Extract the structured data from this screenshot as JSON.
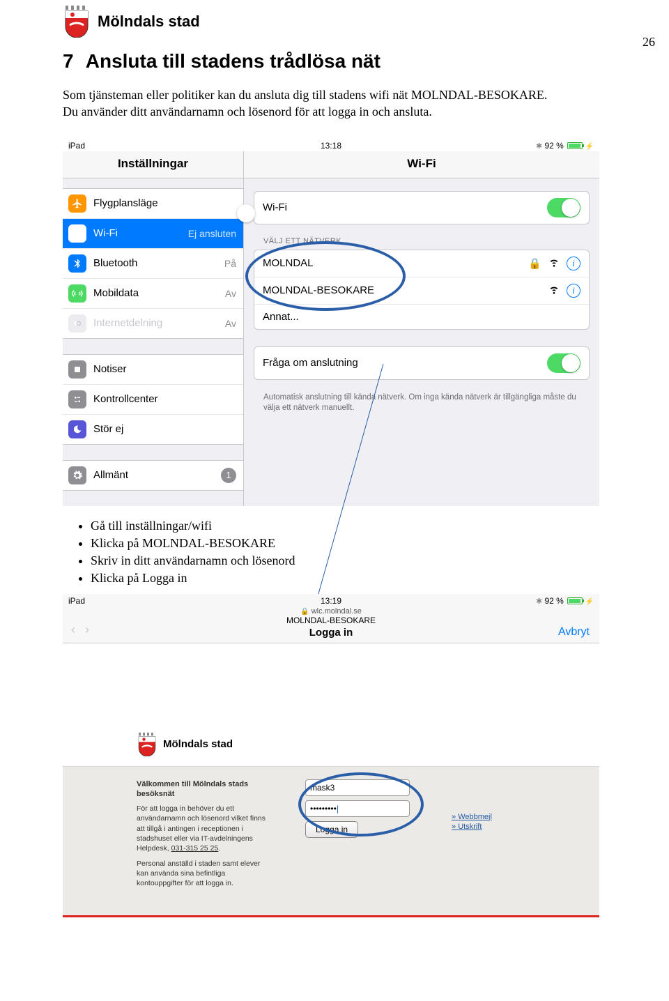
{
  "doc": {
    "brand": "Mölndals stad",
    "page_number": "26",
    "section_number": "7",
    "section_title": "Ansluta till stadens trådlösa nät",
    "para1": "Som tjänsteman eller politiker kan du ansluta dig till stadens wifi nät MOLNDAL-BESOKARE.",
    "para2": "Du använder ditt användarnamn och lösenord för att logga in och ansluta.",
    "bullets": [
      "Gå till inställningar/wifi",
      "Klicka på MOLNDAL-BESOKARE",
      "Skriv in ditt användarnamn och lösenord",
      "Klicka på Logga in"
    ]
  },
  "shot1": {
    "device": "iPad",
    "time": "13:18",
    "battery": "92 %",
    "left_title": "Inställningar",
    "right_title": "Wi-Fi",
    "group1": [
      {
        "icon": "airplane",
        "color": "#ff9500",
        "label": "Flygplansläge",
        "value": "",
        "toggle": "off"
      },
      {
        "icon": "wifi",
        "color": "#007aff",
        "label": "Wi-Fi",
        "value": "Ej ansluten",
        "selected": true
      },
      {
        "icon": "bluetooth",
        "color": "#007aff",
        "label": "Bluetooth",
        "value": "På"
      },
      {
        "icon": "cellular",
        "color": "#4cd964",
        "label": "Mobildata",
        "value": "Av"
      },
      {
        "icon": "hotspot",
        "color": "#d1d1d6",
        "label": "Internetdelning",
        "value": "Av",
        "disabled": true
      }
    ],
    "group2": [
      {
        "icon": "notif",
        "color": "#8e8e93",
        "label": "Notiser"
      },
      {
        "icon": "control",
        "color": "#8e8e93",
        "label": "Kontrollcenter"
      },
      {
        "icon": "dnd",
        "color": "#5856d6",
        "label": "Stör ej"
      }
    ],
    "group3": [
      {
        "icon": "general",
        "color": "#8e8e93",
        "label": "Allmänt",
        "badge": "1"
      }
    ],
    "wifi_toggle_label": "Wi-Fi",
    "choose_label": "VÄLJ ETT NÄTVERK...",
    "networks": [
      {
        "name": "MOLNDAL",
        "locked": true,
        "info": true
      },
      {
        "name": "MOLNDAL-BESOKARE",
        "locked": false,
        "info": true
      },
      {
        "name": "Annat...",
        "locked": false,
        "info": false
      }
    ],
    "ask_label": "Fråga om anslutning",
    "ask_note": "Automatisk anslutning till kända nätverk. Om inga kända nätverk är tillgängliga måste du välja ett nätverk manuellt."
  },
  "shot2": {
    "device": "iPad",
    "time": "13:19",
    "battery": "92 %",
    "url": "wlc.molndal.se",
    "netname": "MOLNDAL-BESOKARE",
    "login": "Logga in",
    "cancel": "Avbryt",
    "brand": "Mölndals stad",
    "welcome_title": "Välkommen till Mölndals stads besöksnät",
    "welcome_p1": "För att logga in behöver du ett användarnamn och lösenord vilket finns att tillgå i antingen i receptionen i stadshuset eller via IT-avdelningens Helpdesk, ",
    "welcome_phone": "031-315 25 25",
    "welcome_p2": "Personal anställd i staden samt elever kan använda sina befintliga kontouppgifter för att logga in.",
    "user_value": "mask3",
    "pass_value": "•••••••••",
    "login_btn": "Logga in",
    "link1": "Webbmejl",
    "link2": "Utskrift"
  }
}
